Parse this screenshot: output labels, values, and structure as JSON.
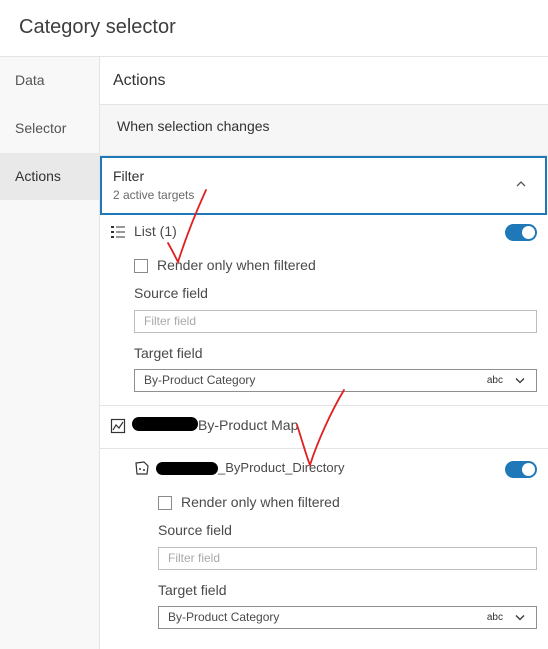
{
  "window": {
    "title": "Category selector"
  },
  "sidebar": {
    "items": [
      {
        "label": "Data"
      },
      {
        "label": "Selector"
      },
      {
        "label": "Actions"
      }
    ]
  },
  "panel": {
    "header": "Actions",
    "trigger": "When selection changes",
    "filter": {
      "label": "Filter",
      "subtitle": "2 active targets"
    }
  },
  "targets": [
    {
      "name": "List (1)",
      "enabled": true,
      "render_only_label": "Render only when filtered",
      "source_label": "Source field",
      "source_placeholder": "Filter field",
      "target_label": "Target field",
      "target_value": "By-Product Category",
      "target_type": "abc"
    },
    {
      "name": "By-Product Map"
    },
    {
      "name": "_ByProduct_Directory",
      "enabled": true,
      "render_only_label": "Render only when filtered",
      "source_label": "Source field",
      "source_placeholder": "Filter field",
      "target_label": "Target field",
      "target_value": "By-Product Category",
      "target_type": "abc"
    }
  ],
  "colors": {
    "accent": "#1f79b8",
    "annotation": "#e02020"
  }
}
